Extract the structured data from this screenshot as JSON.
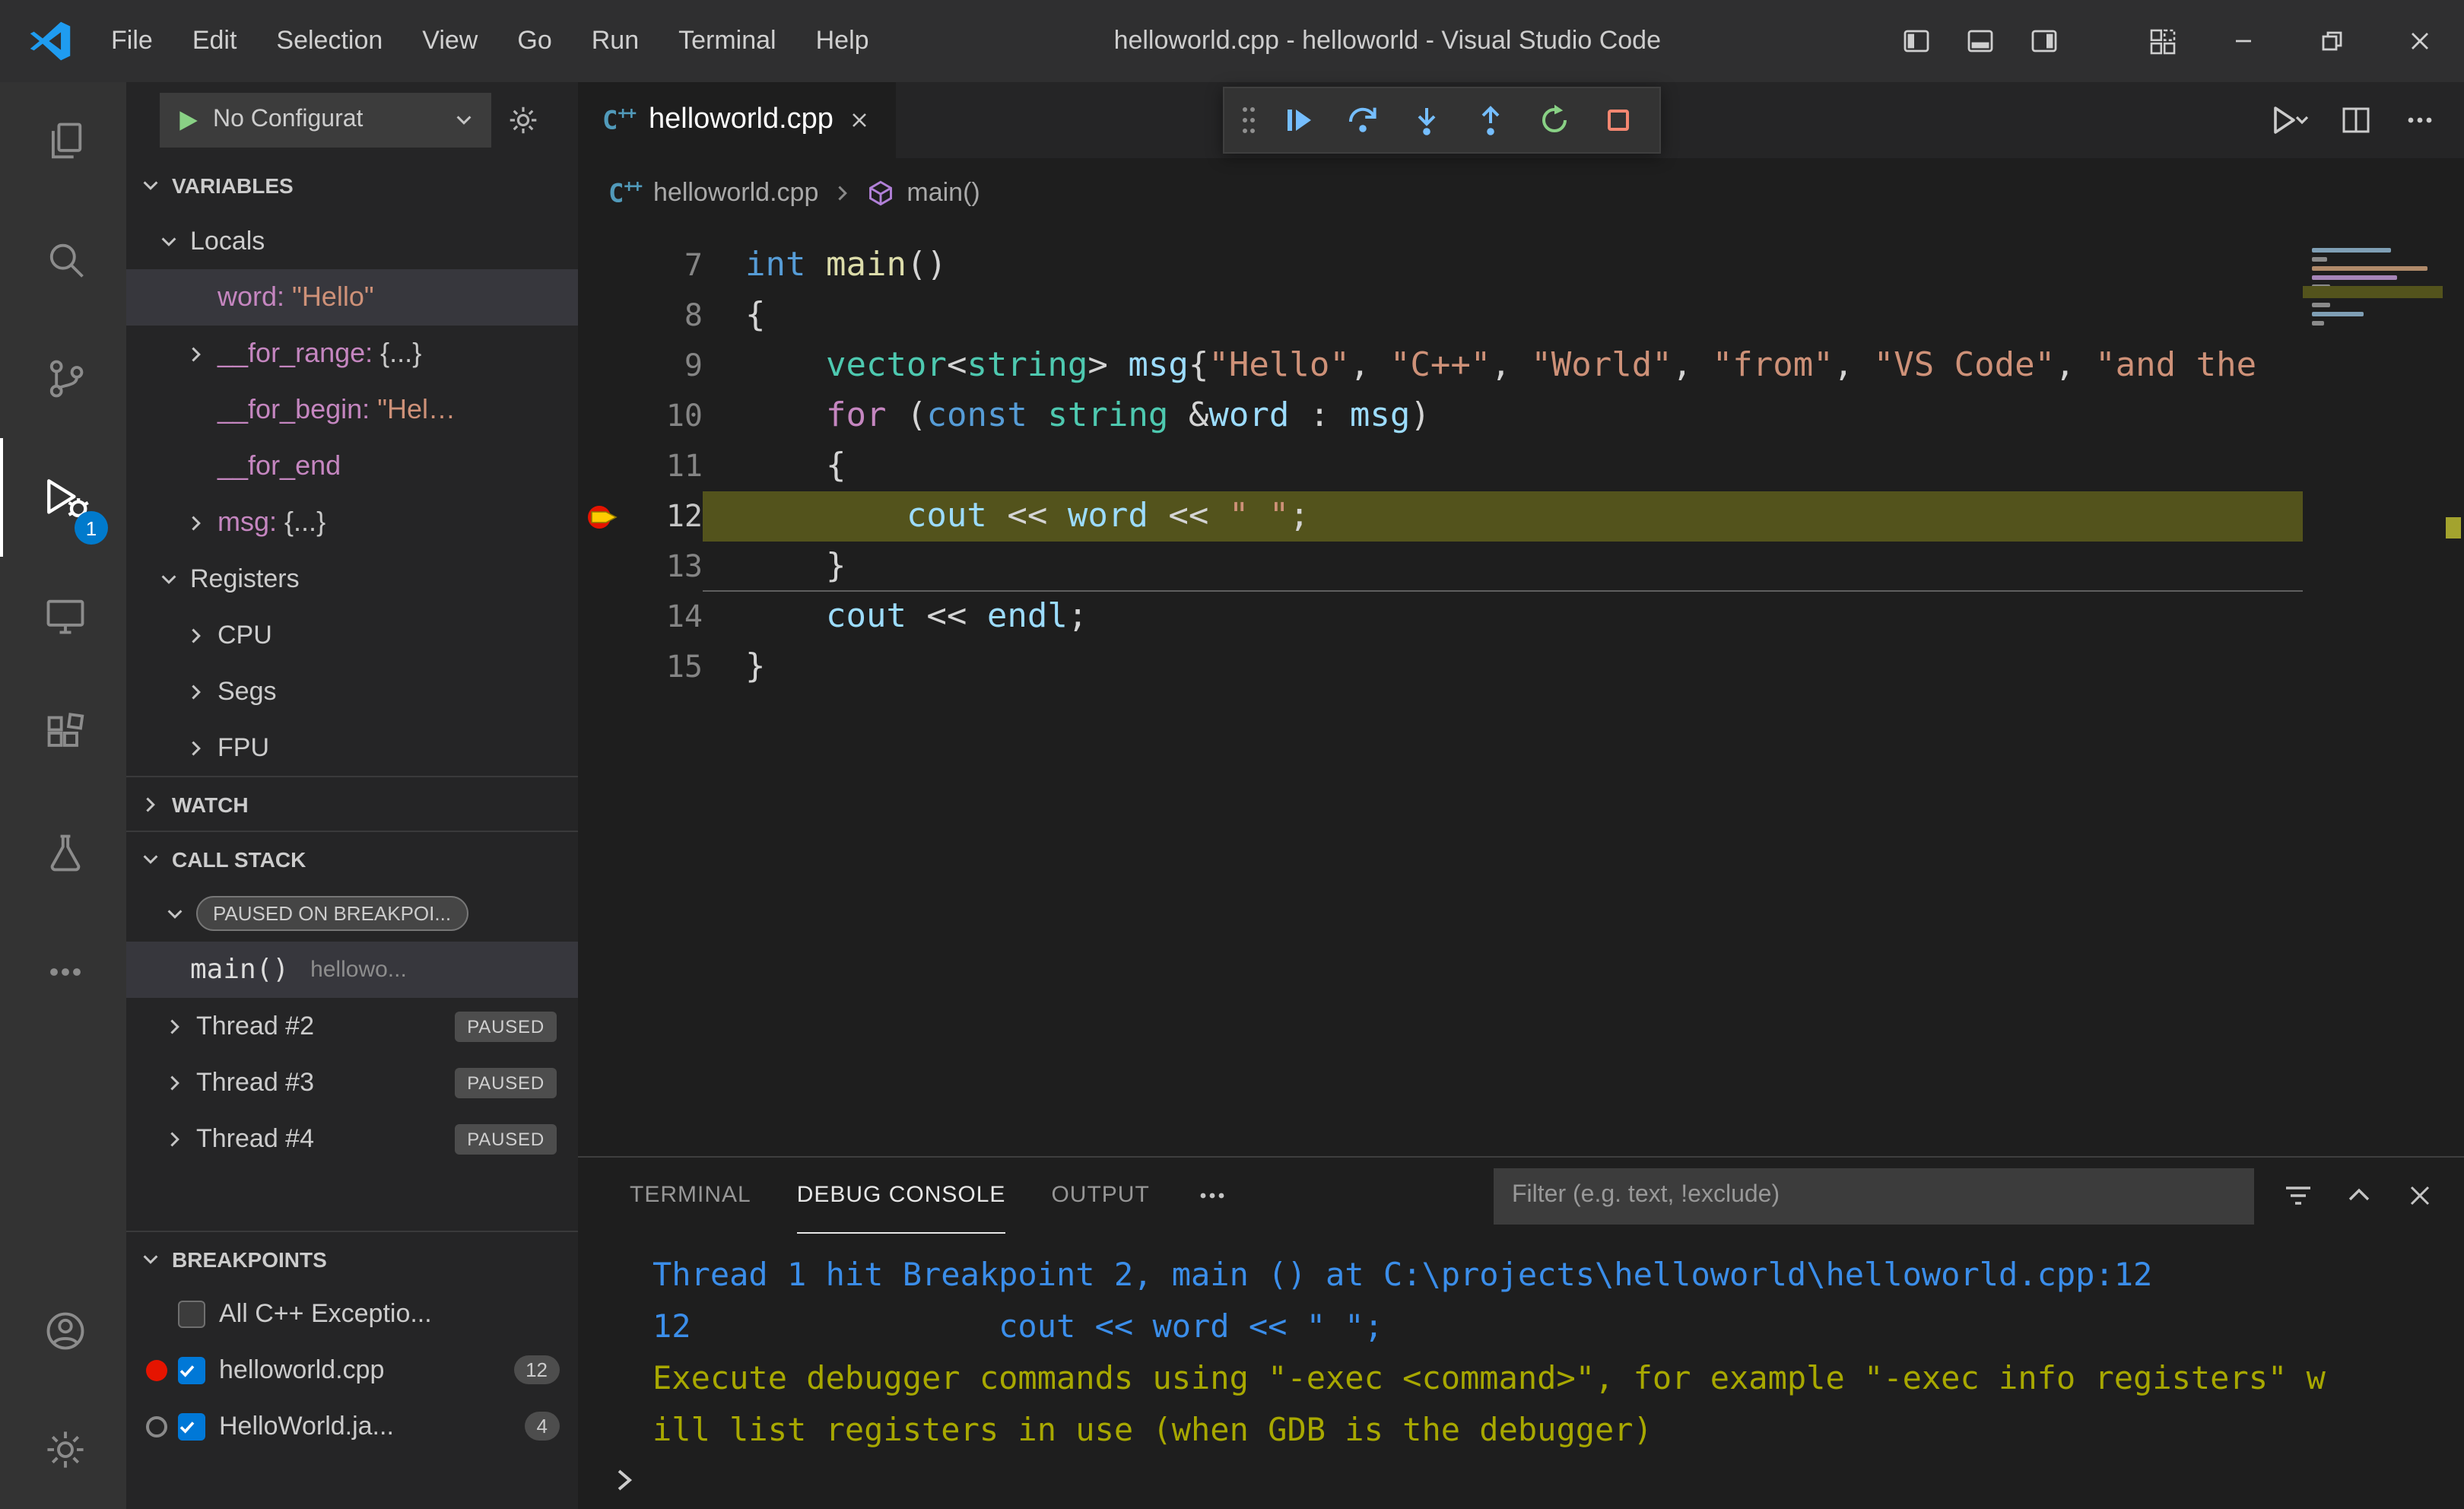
{
  "title_bar": {
    "menus": [
      "File",
      "Edit",
      "Selection",
      "View",
      "Go",
      "Run",
      "Terminal",
      "Help"
    ],
    "title": "helloworld.cpp - helloworld - Visual Studio Code"
  },
  "activity_bar": {
    "debug_badge": "1"
  },
  "sidebar": {
    "debug_config": {
      "label": "No Configurat"
    },
    "variables": {
      "header": "VARIABLES",
      "locals_label": "Locals",
      "registers_label": "Registers",
      "locals": [
        {
          "name": "word:",
          "value": "\"Hello\"",
          "kind": "string",
          "expandable": false,
          "selected": true
        },
        {
          "name": "__for_range:",
          "value": "{...}",
          "kind": "object",
          "expandable": true,
          "selected": false
        },
        {
          "name": "__for_begin:",
          "value": "\"Hel…",
          "kind": "string",
          "expandable": false,
          "selected": false
        },
        {
          "name": "__for_end",
          "value": "",
          "kind": "object",
          "expandable": false,
          "selected": false
        },
        {
          "name": "msg:",
          "value": "{...}",
          "kind": "object",
          "expandable": true,
          "selected": false
        }
      ],
      "registers": [
        "CPU",
        "Segs",
        "FPU"
      ]
    },
    "watch": {
      "header": "WATCH"
    },
    "call_stack": {
      "header": "CALL STACK",
      "status_badge": "PAUSED ON BREAKPOI...",
      "frame_name": "main()",
      "frame_detail": "hellowo...",
      "threads": [
        {
          "label": "Thread #2",
          "status": "PAUSED"
        },
        {
          "label": "Thread #3",
          "status": "PAUSED"
        },
        {
          "label": "Thread #4",
          "status": "PAUSED"
        }
      ]
    },
    "breakpoints": {
      "header": "BREAKPOINTS",
      "items": [
        {
          "marker": "none",
          "checked": false,
          "label": "All C++ Exceptio...",
          "count": ""
        },
        {
          "marker": "red",
          "checked": true,
          "label": "helloworld.cpp",
          "count": "12"
        },
        {
          "marker": "circle",
          "checked": true,
          "label": "HelloWorld.ja...",
          "count": "4"
        }
      ]
    }
  },
  "editor": {
    "tab_label": "helloworld.cpp",
    "breadcrumb": {
      "file": "helloworld.cpp",
      "symbol": "main()"
    },
    "lines": [
      {
        "num": "7",
        "tokens": [
          [
            "int",
            "kw"
          ],
          [
            " ",
            "pl"
          ],
          [
            "main",
            "fn"
          ],
          [
            "()",
            "pl"
          ]
        ]
      },
      {
        "num": "8",
        "tokens": [
          [
            "{",
            "pl"
          ]
        ]
      },
      {
        "num": "9",
        "tokens": [
          [
            "    ",
            "pl"
          ],
          [
            "vector",
            "type"
          ],
          [
            "<",
            "pl"
          ],
          [
            "string",
            "type"
          ],
          [
            "> ",
            "pl"
          ],
          [
            "msg",
            "var"
          ],
          [
            "{",
            "pl"
          ],
          [
            "\"Hello\"",
            "str"
          ],
          [
            ", ",
            "pl"
          ],
          [
            "\"C++\"",
            "str"
          ],
          [
            ", ",
            "pl"
          ],
          [
            "\"World\"",
            "str"
          ],
          [
            ", ",
            "pl"
          ],
          [
            "\"from\"",
            "str"
          ],
          [
            ", ",
            "pl"
          ],
          [
            "\"VS Code\"",
            "str"
          ],
          [
            ", ",
            "pl"
          ],
          [
            "\"and the",
            "str"
          ]
        ]
      },
      {
        "num": "10",
        "tokens": [
          [
            "    ",
            "pl"
          ],
          [
            "for",
            "ctrl"
          ],
          [
            " (",
            "pl"
          ],
          [
            "const",
            "kw"
          ],
          [
            " ",
            "pl"
          ],
          [
            "string",
            "type"
          ],
          [
            " &",
            "pl"
          ],
          [
            "word",
            "var"
          ],
          [
            " : ",
            "pl"
          ],
          [
            "msg",
            "var"
          ],
          [
            ")",
            "pl"
          ]
        ]
      },
      {
        "num": "11",
        "tokens": [
          [
            "    {",
            "pl"
          ]
        ]
      },
      {
        "num": "12",
        "current": true,
        "tokens": [
          [
            "        ",
            "pl"
          ],
          [
            "cout",
            "var"
          ],
          [
            " << ",
            "pl"
          ],
          [
            "word",
            "var"
          ],
          [
            " << ",
            "pl"
          ],
          [
            "\" \"",
            "str"
          ],
          [
            ";",
            "pl"
          ]
        ]
      },
      {
        "num": "13",
        "underline": true,
        "tokens": [
          [
            "    }",
            "pl"
          ]
        ]
      },
      {
        "num": "14",
        "tokens": [
          [
            "    ",
            "pl"
          ],
          [
            "cout",
            "var"
          ],
          [
            " << ",
            "pl"
          ],
          [
            "endl",
            "var"
          ],
          [
            ";",
            "pl"
          ]
        ]
      },
      {
        "num": "15",
        "tokens": [
          [
            "}",
            "pl"
          ]
        ]
      }
    ]
  },
  "panel": {
    "tabs": [
      "TERMINAL",
      "DEBUG CONSOLE",
      "OUTPUT"
    ],
    "active_tab": "DEBUG CONSOLE",
    "filter_placeholder": "Filter (e.g. text, !exclude)",
    "console_lines": [
      {
        "kind": "info",
        "text": "Thread 1 hit Breakpoint 2, main () at C:\\projects\\helloworld\\helloworld.cpp:12"
      },
      {
        "kind": "info",
        "text": "12                cout << word << \" \";"
      },
      {
        "kind": "warn",
        "text": "Execute debugger commands using \"-exec <command>\", for example \"-exec info registers\" w"
      },
      {
        "kind": "warn",
        "text": "ill list registers in use (when GDB is the debugger)"
      }
    ]
  }
}
